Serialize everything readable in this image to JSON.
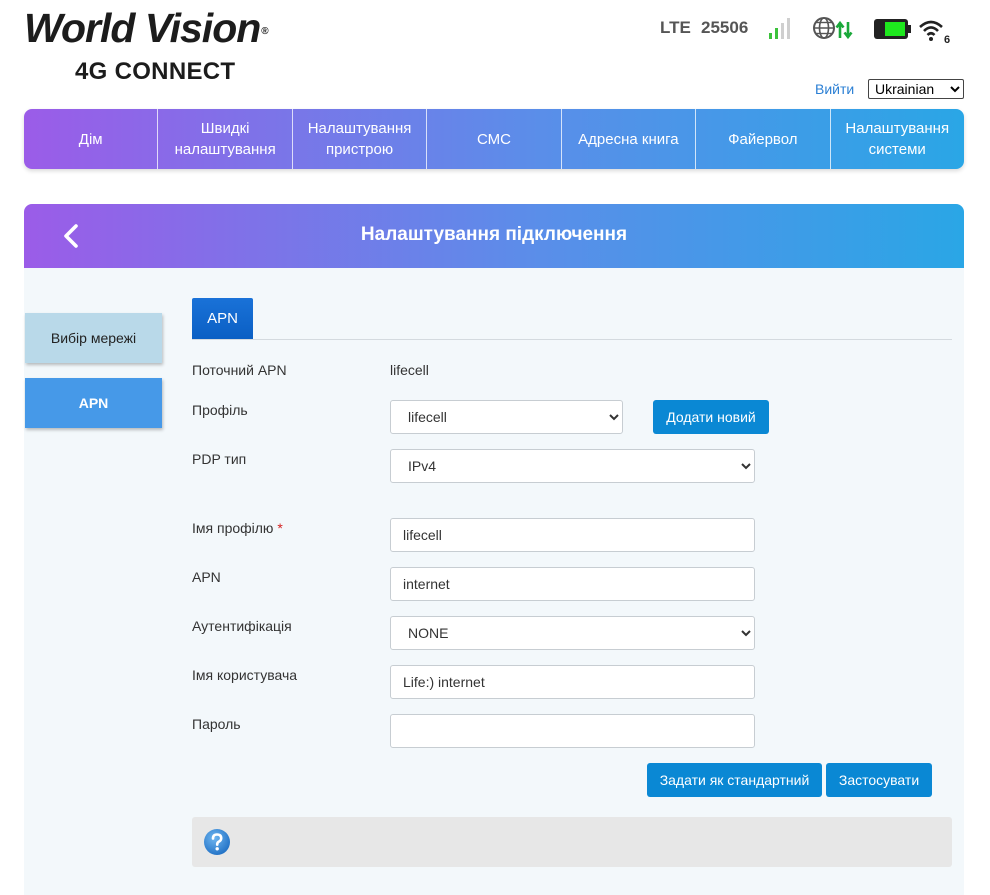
{
  "brand": {
    "name": "World Vision",
    "registered": "®",
    "subtitle": "4G CONNECT"
  },
  "status": {
    "network_type": "LTE",
    "network_code": "25506",
    "signal_icon": "signal-bars-icon",
    "data_icon": "globe-data-icon",
    "battery_icon": "battery-icon",
    "wifi_icon": "wifi-icon",
    "wifi_clients": "6",
    "colors": {
      "signal": "#3cc23c",
      "battery_fill": "#1ee81e",
      "data_arrows": "#1aa83a"
    }
  },
  "header": {
    "logout": "Вийти",
    "language": {
      "selected": "Ukrainian",
      "options": [
        "Ukrainian"
      ]
    }
  },
  "nav": {
    "items": [
      {
        "label": "Дім"
      },
      {
        "label": "Швидкі налаштування"
      },
      {
        "label": "Налаштування пристрою"
      },
      {
        "label": "СМС"
      },
      {
        "label": "Адресна книга"
      },
      {
        "label": "Файервол"
      },
      {
        "label": "Налаштування системи"
      }
    ]
  },
  "panel": {
    "title": "Налаштування підключення",
    "back_icon": "chevron-left-icon"
  },
  "sidebar": {
    "items": [
      {
        "label": "Вибір мережі",
        "active": false
      },
      {
        "label": "APN",
        "active": true
      }
    ]
  },
  "tabs": {
    "items": [
      {
        "label": "APN",
        "active": true
      }
    ]
  },
  "form": {
    "current_apn": {
      "label": "Поточний APN",
      "value": "lifecell"
    },
    "profile": {
      "label": "Профіль",
      "value": "lifecell",
      "add_button": "Додати новий"
    },
    "pdp_type": {
      "label": "PDP тип",
      "value": "IPv4"
    },
    "profile_name": {
      "label": "Імя профілю",
      "required_mark": "*",
      "value": "lifecell"
    },
    "apn": {
      "label": "APN",
      "value": "internet"
    },
    "auth": {
      "label": "Аутентифікація",
      "value": "NONE"
    },
    "username": {
      "label": "Імя користувача",
      "value": "Life:) internet"
    },
    "password": {
      "label": "Пароль",
      "value": ""
    }
  },
  "actions": {
    "set_default": "Задати як стандартний",
    "apply": "Застосувати"
  },
  "help": {
    "icon": "help-question-icon",
    "color": "#2f86d6"
  },
  "theme": {
    "gradient_start": "#9b5ce8",
    "gradient_end": "#2aa6e6",
    "button": "#0a88d4",
    "tab": "#0a5fc4"
  }
}
